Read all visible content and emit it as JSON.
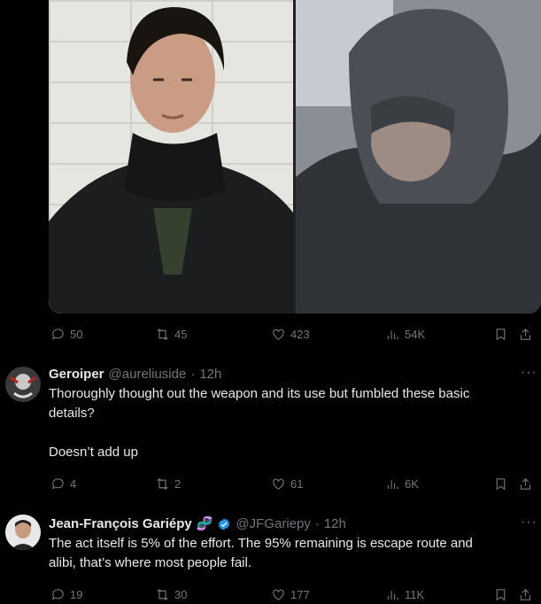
{
  "main_post": {
    "stats": {
      "replies": "50",
      "reposts": "45",
      "likes": "423",
      "views": "54K"
    }
  },
  "replies": [
    {
      "name": "Geroiper",
      "handle": "@aureliuside",
      "separator": "·",
      "time": "12h",
      "text_line1": "Thoroughly thought out the weapon and its use but fumbled these basic",
      "text_line2": "details?",
      "text_line3": "Doesn’t add up",
      "stats": {
        "replies": "4",
        "reposts": "2",
        "likes": "61",
        "views": "6K"
      }
    },
    {
      "name": "Jean-François Gariépy",
      "emoji": "🧬",
      "handle": "@JFGariepy",
      "separator": "·",
      "time": "12h",
      "text_line1": "The act itself is 5% of the effort. The 95% remaining is escape route and",
      "text_line2": "alibi, that’s where most people fail.",
      "stats": {
        "replies": "19",
        "reposts": "30",
        "likes": "177",
        "views": "11K"
      }
    }
  ],
  "colors": {
    "background": "#000000",
    "text": "#e7e9ea",
    "muted": "#71767b",
    "verified": "#1d9bf0"
  }
}
